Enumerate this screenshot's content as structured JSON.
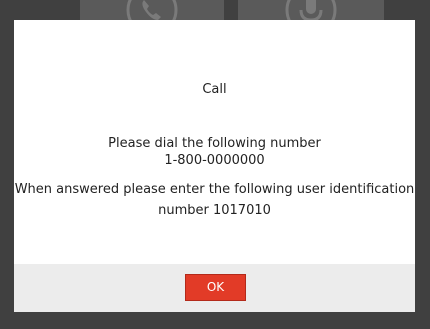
{
  "dialog": {
    "title": "Call",
    "instruction": "Please dial the following number",
    "phone_number": "1-800-0000000",
    "answer_prompt": "When answered please enter the following user identification",
    "user_id_line": "number 1017010",
    "ok_label": "OK"
  },
  "background": {
    "icons": [
      "phone-icon",
      "microphone-icon"
    ]
  },
  "colors": {
    "overlay": "#404040",
    "tile": "#5a5a5a",
    "dialog": "#ffffff",
    "footer": "#ececec",
    "ok_button": "#e23b27"
  }
}
